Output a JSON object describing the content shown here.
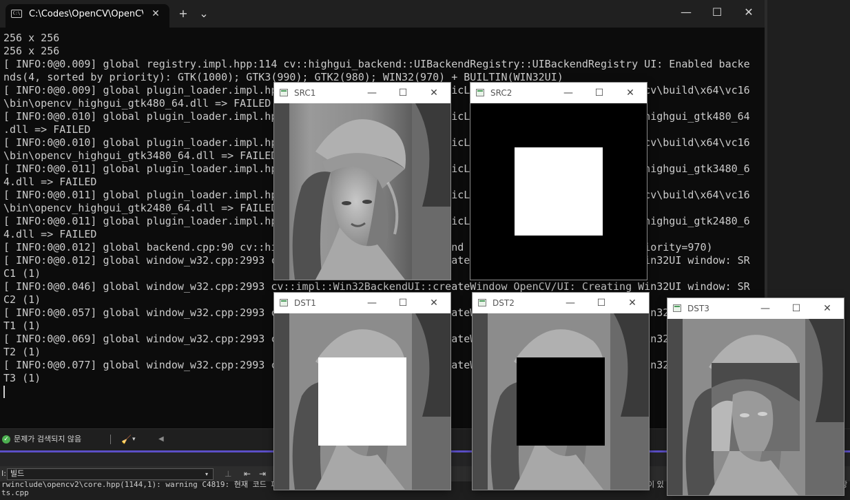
{
  "terminal": {
    "tab_title": "C:\\Codes\\OpenCV\\OpenCV",
    "tab_close_glyph": "✕",
    "new_tab_glyph": "+",
    "dropdown_glyph": "⌄",
    "minimize_glyph": "—",
    "maximize_glyph": "☐",
    "close_glyph": "✕",
    "lines": [
      "256 x 256",
      "256 x 256",
      "[ INFO:0@0.009] global registry.impl.hpp:114 cv::highgui_backend::UIBackendRegistry::UIBackendRegistry UI: Enabled backe",
      "nds(4, sorted by priority): GTK(1000); GTK3(990); GTK2(980); WIN32(970) + BUILTIN(WIN32UI)",
      "[ INFO:0@0.009] global plugin_loader.impl.hpp:67 cv::plugin::impl::DynamicLib::libraryLoad load C:\\opencv\\build\\x64\\vc16",
      "\\bin\\opencv_highgui_gtk480_64.dll => FAILED",
      "[ INFO:0@0.010] global plugin_loader.impl.hpp:67 cv::plugin::impl::DynamicLib::libraryLoad load opencv_highgui_gtk480_64",
      ".dll => FAILED",
      "[ INFO:0@0.010] global plugin_loader.impl.hpp:67 cv::plugin::impl::DynamicLib::libraryLoad load C:\\opencv\\build\\x64\\vc16",
      "\\bin\\opencv_highgui_gtk3480_64.dll => FAILED",
      "[ INFO:0@0.011] global plugin_loader.impl.hpp:67 cv::plugin::impl::DynamicLib::libraryLoad load opencv_highgui_gtk3480_6",
      "4.dll => FAILED",
      "[ INFO:0@0.011] global plugin_loader.impl.hpp:67 cv::plugin::impl::DynamicLib::libraryLoad load C:\\opencv\\build\\x64\\vc16",
      "\\bin\\opencv_highgui_gtk2480_64.dll => FAILED",
      "[ INFO:0@0.011] global plugin_loader.impl.hpp:67 cv::plugin::impl::DynamicLib::libraryLoad load opencv_highgui_gtk2480_6",
      "4.dll => FAILED",
      "[ INFO:0@0.012] global backend.cpp:90 cv::highgui_backend::createUIBackend UI: using backend: WIN32 (priority=970)",
      "[ INFO:0@0.012] global window_w32.cpp:2993 cv::impl::Win32BackendUI::createWindow OpenCV/UI: Creating Win32UI window: SR",
      "C1 (1)",
      "[ INFO:0@0.046] global window_w32.cpp:2993 cv::impl::Win32BackendUI::createWindow OpenCV/UI: Creating Win32UI window: SR",
      "C2 (1)",
      "[ INFO:0@0.057] global window_w32.cpp:2993 cv::impl::Win32BackendUI::createWindow OpenCV/UI: Creating Win32UI window: DS",
      "T1 (1)",
      "[ INFO:0@0.069] global window_w32.cpp:2993 cv::impl::Win32BackendUI::createWindow OpenCV/UI: Creating Win32UI window: DS",
      "T2 (1)",
      "[ INFO:0@0.077] global window_w32.cpp:2993 cv::impl::Win32BackendUI::createWindow OpenCV/UI: Creating Win32UI window: DS",
      "T3 (1)"
    ]
  },
  "windows": {
    "src1": {
      "title": "SRC1"
    },
    "src2": {
      "title": "SRC2"
    },
    "dst1": {
      "title": "DST1"
    },
    "dst2": {
      "title": "DST2"
    },
    "dst3": {
      "title": "DST3"
    },
    "minimize_glyph": "—",
    "maximize_glyph": "☐",
    "close_glyph": "✕"
  },
  "ide": {
    "status_text": "문제가 검색되지 않음",
    "status_ok_glyph": "✓",
    "brush_glyph": "🧹",
    "caret_glyph": "▾",
    "left_tri_glyph": "◀",
    "output_label": "I:",
    "build_select": "빌드",
    "select_arrow": "▾",
    "output_line_1": "rwinclude\\opencv2\\core.hpp(1144,1): warning C4819: 현재 코드 페이",
    "output_line_2": "ts.cpp",
    "output_line_1_end": "이 있",
    "output_line_1_far": "저장"
  }
}
